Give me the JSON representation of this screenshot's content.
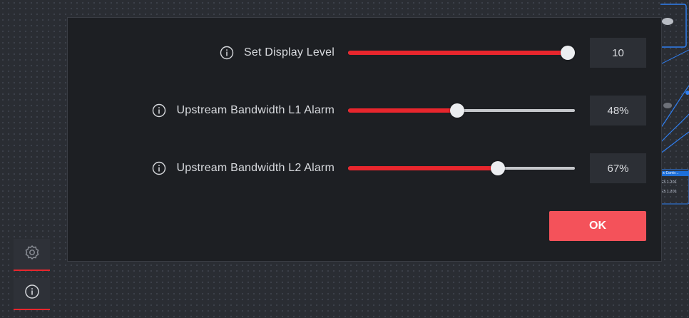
{
  "dialog": {
    "settings": [
      {
        "label": "Set Display Level",
        "value_text": "10",
        "value": 10,
        "max": 10,
        "level_fraction": 1.0
      },
      {
        "label": "Upstream Bandwidth L1 Alarm",
        "value_text": "48%",
        "value": 48,
        "max": 100,
        "level_fraction": 0.48
      },
      {
        "label": "Upstream Bandwidth L2 Alarm",
        "value_text": "67%",
        "value": 67,
        "max": 100,
        "level_fraction": 0.67
      }
    ],
    "ok_label": "OK"
  },
  "toolbar": {
    "buttons": [
      {
        "icon": "gear-icon"
      },
      {
        "icon": "info-icon"
      }
    ]
  },
  "background": {
    "node_title": "x Contr...",
    "node_lines": [
      "G3.1.201",
      "G3.1.201"
    ]
  },
  "colors": {
    "accent": "#e8262d",
    "ok_button": "#f4525a",
    "dialog_bg": "#1d1f23",
    "value_box_bg": "#2c2f35",
    "page_bg": "#2a2d33",
    "topology_link": "#2f7ef0"
  }
}
